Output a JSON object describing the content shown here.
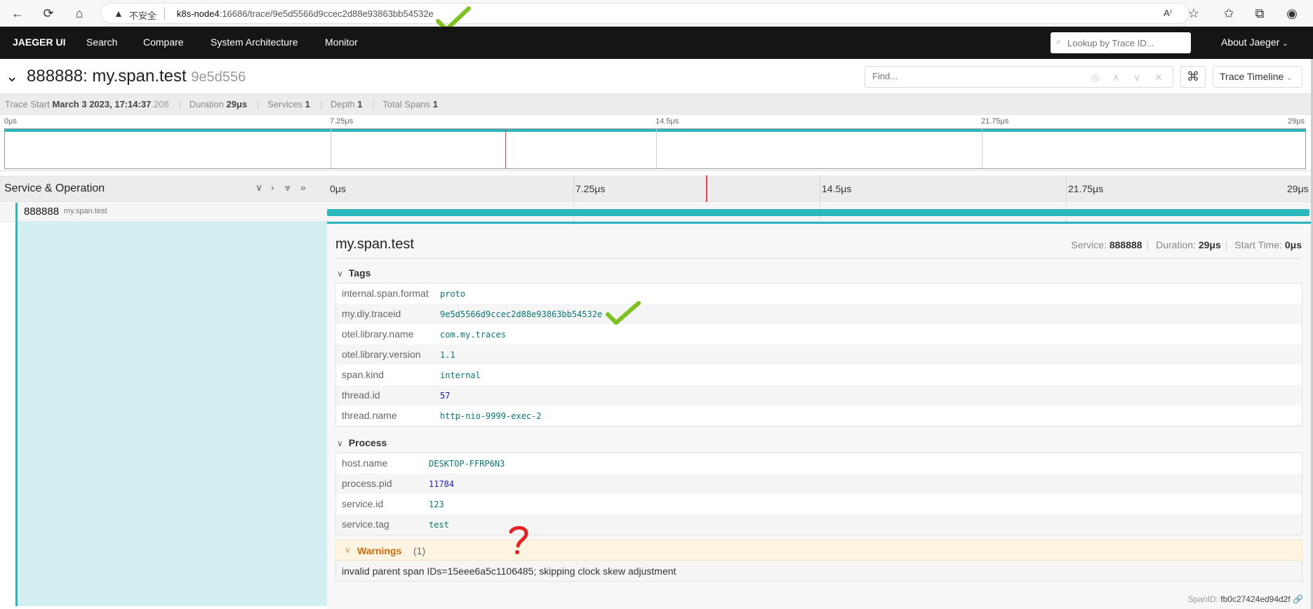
{
  "browser": {
    "insecure_label": "不安全",
    "url_host": "k8s-node4",
    "url_rest": ":16686/trace/9e5d5566d9ccec2d88e93863bb54532e"
  },
  "nav": {
    "logo": "JAEGER UI",
    "items": [
      "Search",
      "Compare",
      "System Architecture",
      "Monitor"
    ],
    "lookup_placeholder": "Lookup by Trace ID...",
    "about": "About Jaeger"
  },
  "trace": {
    "title": "888888: my.span.test",
    "trace_id_short": "9e5d556",
    "find_placeholder": "Find...",
    "view_mode": "Trace Timeline"
  },
  "summary": {
    "trace_start_label": "Trace Start",
    "trace_start_value": "March 3 2023, 17:14:37",
    "trace_start_ms": ".208",
    "duration_label": "Duration",
    "duration_value": "29μs",
    "services_label": "Services",
    "services_value": "1",
    "depth_label": "Depth",
    "depth_value": "1",
    "total_spans_label": "Total Spans",
    "total_spans_value": "1"
  },
  "minimap": {
    "ticks": [
      "0μs",
      "7.25μs",
      "14.5μs",
      "21.75μs",
      "29μs"
    ]
  },
  "timeline": {
    "header_label": "Service & Operation",
    "ticks": [
      "0μs",
      "7.25μs",
      "14.5μs",
      "21.75μs",
      "29μs"
    ]
  },
  "span": {
    "service": "888888",
    "operation": "my.span.test"
  },
  "detail": {
    "title": "my.span.test",
    "service_label": "Service:",
    "service_value": "888888",
    "duration_label": "Duration:",
    "duration_value": "29μs",
    "start_label": "Start Time:",
    "start_value": "0μs",
    "tags_label": "Tags",
    "tags": [
      {
        "key": "internal.span.format",
        "value": "proto"
      },
      {
        "key": "my.diy.traceid",
        "value": "9e5d5566d9ccec2d88e93863bb54532e"
      },
      {
        "key": "otel.library.name",
        "value": "com.my.traces"
      },
      {
        "key": "otel.library.version",
        "value": "1.1"
      },
      {
        "key": "span.kind",
        "value": "internal"
      },
      {
        "key": "thread.id",
        "value": "57"
      },
      {
        "key": "thread.name",
        "value": "http-nio-9999-exec-2"
      }
    ],
    "process_label": "Process",
    "process": [
      {
        "key": "host.name",
        "value": "DESKTOP-FFRP6N3"
      },
      {
        "key": "process.pid",
        "value": "11784"
      },
      {
        "key": "service.id",
        "value": "123"
      },
      {
        "key": "service.tag",
        "value": "test"
      }
    ],
    "warnings_label": "Warnings",
    "warnings_count": "(1)",
    "warning_message": "invalid parent span IDs=15eee6a5c1106485; skipping clock skew adjustment",
    "spanid_label": "SpanID:",
    "spanid_value": "fb0c27424ed94d2f"
  },
  "colors": {
    "accent": "#2cb7bd",
    "nav_bg": "#151515",
    "warning": "#cc6a0a",
    "annotation_check": "#7dc21e",
    "annotation_question": "#e82020"
  }
}
